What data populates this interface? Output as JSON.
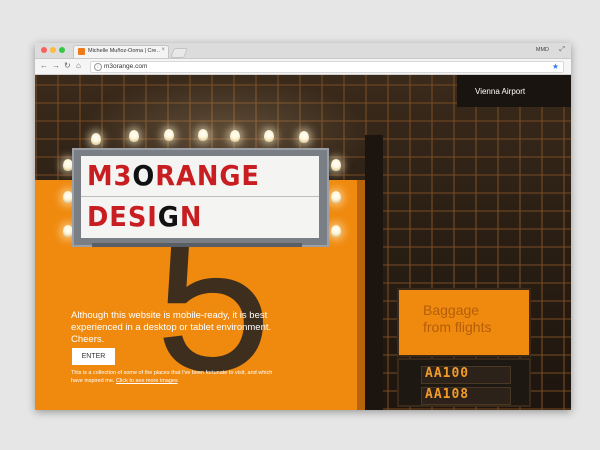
{
  "browser": {
    "tab_title": "Michelle Muñoz-Ooma | Cre…",
    "tab_close": "×",
    "user": "MMD",
    "url": "m3orange.com",
    "nav": {
      "back": "←",
      "forward": "→",
      "reload": "↻",
      "home": "⌂"
    },
    "star": "★",
    "expand": "⤢",
    "info": "i"
  },
  "page": {
    "location_label": "Vienna Airport",
    "sign_line1": [
      "M3",
      "O",
      "RANGE"
    ],
    "sign_line2": [
      "DESI",
      "G",
      "N"
    ],
    "big_number": "5",
    "baggage_line1": "Baggage",
    "baggage_line2": "from flights",
    "board_row1": "AA100",
    "board_row2": "AA108",
    "message": "Although this website is mobile-ready, it is best experienced in a desktop or tablet environment. Cheers.",
    "enter_label": "ENTER",
    "note_text": "This is a collection of some of the places that I've been fortunate to visit, and which have inspired me.",
    "note_link": "Click to see more images"
  },
  "colors": {
    "accent_orange": "#f08a0f",
    "sign_red": "#c81e22",
    "chrome_star": "#3b80e6"
  }
}
